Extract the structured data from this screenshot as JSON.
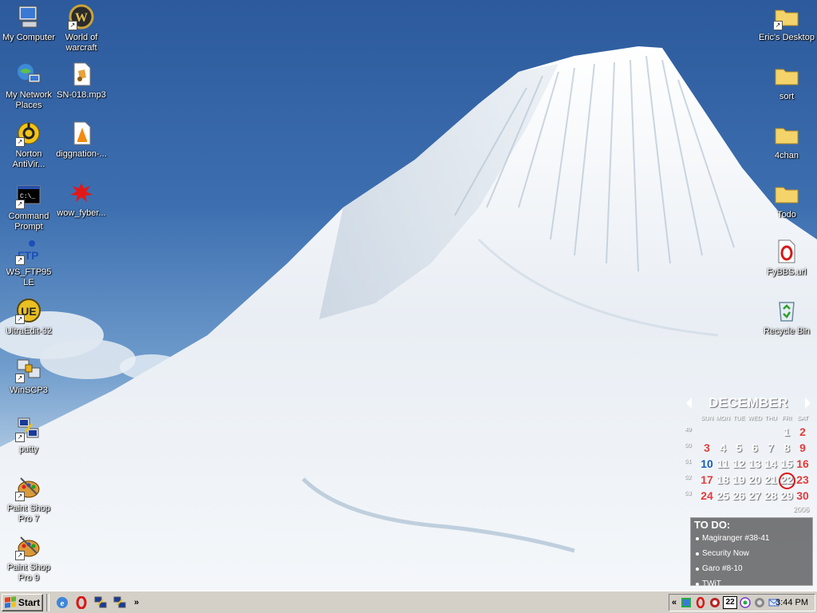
{
  "desktop_icons_left": [
    {
      "label": "My Computer",
      "icon": "computer-icon"
    },
    {
      "label": "World of warcraft",
      "icon": "wow-icon"
    },
    {
      "label": "My Network Places",
      "icon": "network-icon"
    },
    {
      "label": "SN-018.mp3",
      "icon": "audio-file-icon"
    },
    {
      "label": "Norton AntiVir...",
      "icon": "norton-icon"
    },
    {
      "label": "diggnation-...",
      "icon": "vlc-file-icon"
    },
    {
      "label": "Command Prompt",
      "icon": "cmd-icon"
    },
    {
      "label": "wow_fyber...",
      "icon": "splat-icon"
    },
    {
      "label": "WS_FTP95 LE",
      "icon": "ftp-icon"
    },
    {
      "label": "UltraEdit-32",
      "icon": "ultraedit-icon"
    },
    {
      "label": "WinSCP3",
      "icon": "winscp-icon"
    },
    {
      "label": "putty",
      "icon": "putty-icon"
    },
    {
      "label": "Paint Shop Pro 7",
      "icon": "paintshop-icon"
    },
    {
      "label": "Paint Shop Pro 9",
      "icon": "paintshop-icon"
    }
  ],
  "desktop_icons_right": [
    {
      "label": "Eric's Desktop",
      "icon": "folder-icon"
    },
    {
      "label": "sort",
      "icon": "folder-icon"
    },
    {
      "label": "4chan",
      "icon": "folder-icon"
    },
    {
      "label": "Todo",
      "icon": "folder-icon"
    },
    {
      "label": "FyBBS.url",
      "icon": "opera-url-icon"
    },
    {
      "label": "Recycle Bin",
      "icon": "recycle-bin-icon"
    }
  ],
  "calendar": {
    "month": "DECEMBER",
    "year": "2006",
    "days_of_week": [
      "SUN",
      "MON",
      "TUE",
      "WED",
      "THU",
      "FRI",
      "SAT"
    ],
    "weeks": [
      {
        "num": "49",
        "days": [
          "",
          "",
          "",
          "",
          "",
          "1",
          "2"
        ]
      },
      {
        "num": "50",
        "days": [
          "3",
          "4",
          "5",
          "6",
          "7",
          "8",
          "9"
        ]
      },
      {
        "num": "51",
        "days": [
          "10",
          "11",
          "12",
          "13",
          "14",
          "15",
          "16"
        ]
      },
      {
        "num": "52",
        "days": [
          "17",
          "18",
          "19",
          "20",
          "21",
          "22",
          "23"
        ]
      },
      {
        "num": "53",
        "days": [
          "24",
          "25",
          "26",
          "27",
          "28",
          "29",
          "30"
        ]
      }
    ],
    "today": "22"
  },
  "todo": {
    "title": "TO DO:",
    "items": [
      "Magiranger #38-41",
      "Security Now",
      "Garo #8-10",
      "TWiT"
    ]
  },
  "taskbar": {
    "start_label": "Start",
    "quick_launch_more": "»",
    "tray_expand": "«",
    "tray_number": "22",
    "clock": "3:44 PM"
  },
  "colors": {
    "weekend_red": "#e23a3a",
    "taskbar_gray": "#d4d0c8",
    "today_circle": "#dd1111"
  }
}
